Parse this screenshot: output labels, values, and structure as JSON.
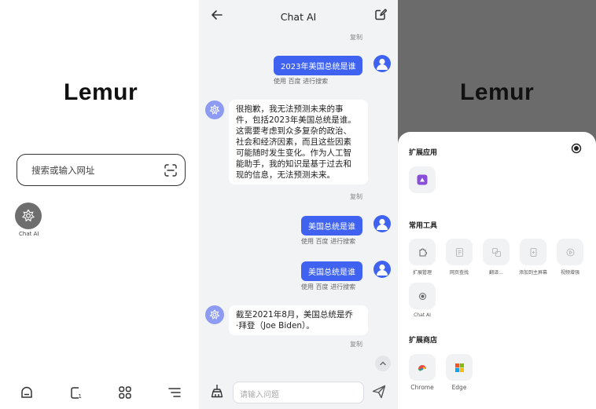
{
  "home": {
    "logo": "Lemur",
    "search_placeholder": "搜索或输入网址",
    "shortcut_label": "Chat AI"
  },
  "chat": {
    "title": "Chat AI",
    "copy_label": "复制",
    "messages": [
      {
        "role": "user",
        "text": "2023年美国总统是谁",
        "meta": "使用 百度 进行搜索"
      },
      {
        "role": "assistant",
        "lines": [
          "很抱歉，我无法预测未来的事",
          "件，包括2023年美国总统是谁。",
          "这需要考虑到众多复杂的政治、",
          "社会和经济因素，而且这些因素",
          "可能随时发生变化。作为人工智",
          "能助手，我的知识是基于过去和",
          "现的信息，无法预测未来。"
        ]
      },
      {
        "role": "user",
        "text": "美国总统是谁",
        "meta": "使用 百度 进行搜索"
      },
      {
        "role": "user",
        "text": "美国总统是谁",
        "meta": "使用 百度 进行搜索"
      },
      {
        "role": "assistant",
        "lines": [
          "截至2021年8月，美国总统是乔",
          "·拜登（Joe Biden）。"
        ]
      }
    ],
    "input_placeholder": "请输入问题"
  },
  "extensions": {
    "logo": "Lemur",
    "section_apps": "扩展应用",
    "section_tools": "常用工具",
    "tools": [
      {
        "label": "扩展管理",
        "icon": "extension-icon"
      },
      {
        "label": "网页查找",
        "icon": "page-find-icon"
      },
      {
        "label": "翻译...",
        "icon": "translate-icon"
      },
      {
        "label": "添加到主屏幕",
        "icon": "add-home-icon"
      },
      {
        "label": "视频增强",
        "icon": "video-enhance-icon"
      },
      {
        "label": "Chat AI",
        "icon": "chat-ai-icon"
      }
    ],
    "section_store": "扩展商店",
    "stores": [
      {
        "label": "Chrome",
        "icon": "chrome-icon"
      },
      {
        "label": "Edge",
        "icon": "edge-icon"
      }
    ]
  },
  "colors": {
    "accent": "#3f63f0",
    "ai_avatar": "#8e9bf2",
    "bg_chat": "#f2f3f5",
    "dim_overlay": "#6b6b6b"
  }
}
